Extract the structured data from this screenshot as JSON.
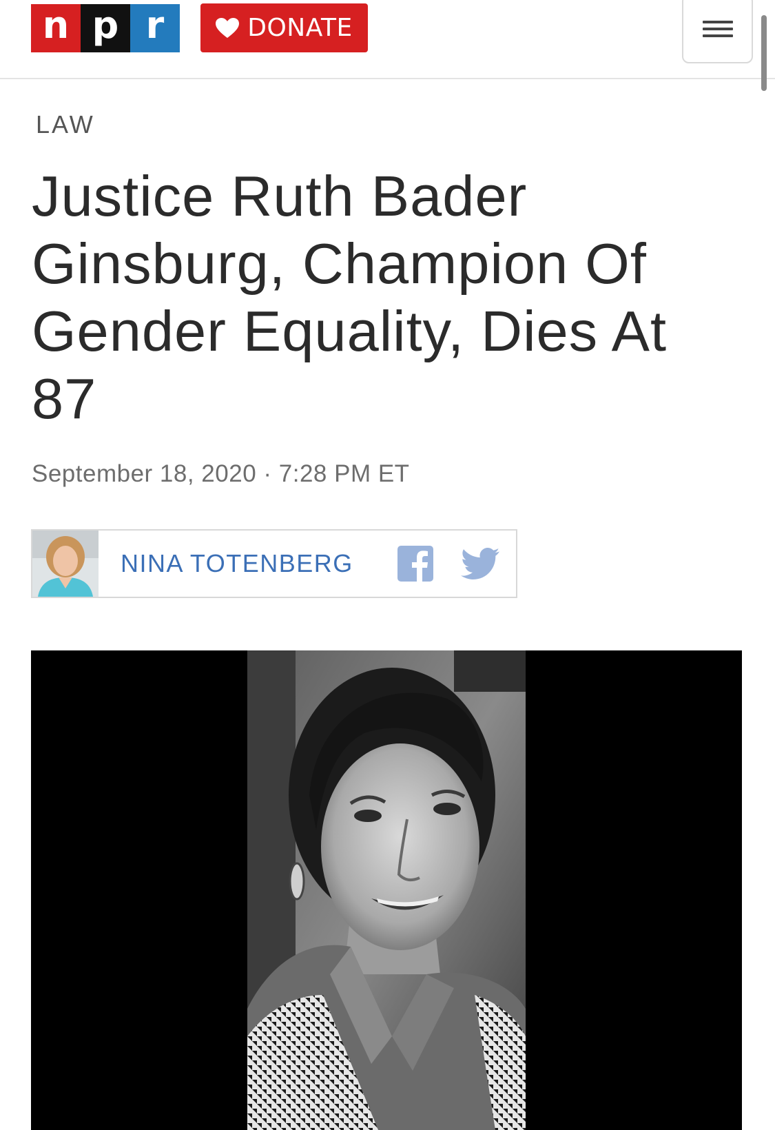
{
  "header": {
    "logo": {
      "letters": [
        "n",
        "p",
        "r"
      ],
      "colors": [
        "#d62021",
        "#111111",
        "#237bbd"
      ]
    },
    "donate": {
      "label": "DONATE",
      "icon": "heart-icon",
      "color": "#d62021"
    },
    "menu": {
      "icon": "hamburger-icon"
    }
  },
  "article": {
    "section": "LAW",
    "headline": "Justice Ruth Bader Ginsburg, Champion Of Gender Equality, Dies At 87",
    "dateline": "September 18, 2020 · 7:28 PM ET",
    "byline": {
      "author": "NINA TOTENBERG",
      "avatar_icon": "author-photo",
      "share": [
        "facebook-icon",
        "twitter-icon"
      ],
      "accent": "#3b6fb6"
    },
    "lead_image": {
      "description_icon": "portrait-photo",
      "style": "black-and-white"
    }
  }
}
